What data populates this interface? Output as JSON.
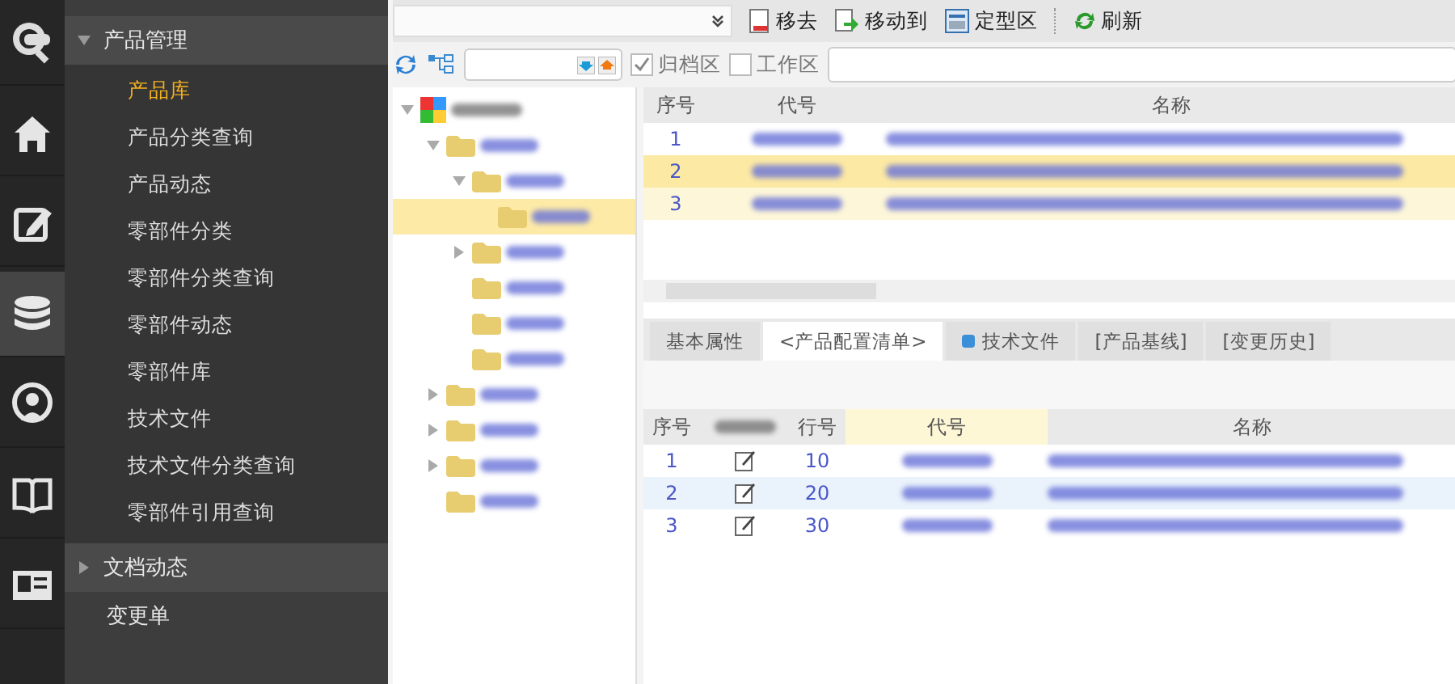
{
  "rail": {
    "items": [
      {
        "kind": "logo",
        "selected": false
      },
      {
        "kind": "home",
        "selected": false
      },
      {
        "kind": "edit",
        "selected": false
      },
      {
        "kind": "database",
        "selected": true
      },
      {
        "kind": "broadcast",
        "selected": false
      },
      {
        "kind": "book",
        "selected": false
      },
      {
        "kind": "card",
        "selected": false
      }
    ]
  },
  "menu": {
    "groups": [
      {
        "label": "产品管理",
        "expanded": true,
        "items": [
          {
            "label": "产品库",
            "selected": true
          },
          {
            "label": "产品分类查询",
            "selected": false
          },
          {
            "label": "产品动态",
            "selected": false
          },
          {
            "label": "零部件分类",
            "selected": false
          },
          {
            "label": "零部件分类查询",
            "selected": false
          },
          {
            "label": "零部件动态",
            "selected": false
          },
          {
            "label": "零部件库",
            "selected": false
          },
          {
            "label": "技术文件",
            "selected": false
          },
          {
            "label": "技术文件分类查询",
            "selected": false
          },
          {
            "label": "零部件引用查询",
            "selected": false
          }
        ]
      },
      {
        "label": "文档动态",
        "expanded": false
      },
      {
        "label": "变更单"
      }
    ]
  },
  "toolbar": {
    "buttons": [
      {
        "kind": "remove",
        "label": "移去"
      },
      {
        "kind": "move",
        "label": "移动到"
      },
      {
        "kind": "fixed",
        "label": "定型区"
      },
      {
        "kind": "refresh",
        "label": "刷新"
      }
    ]
  },
  "filter": {
    "checkboxes": [
      {
        "label": "归档区",
        "checked": true
      },
      {
        "label": "工作区",
        "checked": false
      }
    ]
  },
  "tree": {
    "nodes": [
      {
        "kind": "root",
        "expanded": true,
        "selected": false,
        "children": [
          {
            "expanded": true,
            "selected": false,
            "children": [
              {
                "expanded": true,
                "selected": false,
                "children": [
                  {
                    "selected": true
                  }
                ]
              },
              {
                "expanded": false,
                "selected": false
              },
              {
                "selected": false
              },
              {
                "selected": false
              },
              {
                "selected": false
              }
            ]
          },
          {
            "expanded": false,
            "selected": false
          },
          {
            "expanded": false,
            "selected": false
          },
          {
            "expanded": false,
            "selected": false
          },
          {
            "selected": false
          }
        ]
      }
    ]
  },
  "upper_table": {
    "columns": [
      "序号",
      "代号",
      "名称"
    ],
    "rows": [
      {
        "number": "1",
        "selected": false,
        "hover": false
      },
      {
        "number": "2",
        "selected": true,
        "hover": false
      },
      {
        "number": "3",
        "selected": false,
        "hover": true
      }
    ]
  },
  "tabs": [
    {
      "label": "基本属性",
      "selected": false
    },
    {
      "label": "<产品配置清单>",
      "selected": true
    },
    {
      "label": "技术文件",
      "selected": false,
      "icon": true
    },
    {
      "label": "[产品基线]",
      "selected": false
    },
    {
      "label": "[变更历史]",
      "selected": false
    }
  ],
  "lower_table": {
    "columns": [
      {
        "label": "序号",
        "sorted": false
      },
      {
        "sorted": false
      },
      {
        "label": "行号",
        "sorted": false
      },
      {
        "label": "代号",
        "sorted": true
      },
      {
        "label": "名称",
        "sorted": false
      }
    ],
    "rows": [
      {
        "number": "1",
        "line": "10",
        "selected": false
      },
      {
        "number": "2",
        "line": "20",
        "selected": true
      },
      {
        "number": "3",
        "line": "30",
        "selected": false
      }
    ]
  }
}
